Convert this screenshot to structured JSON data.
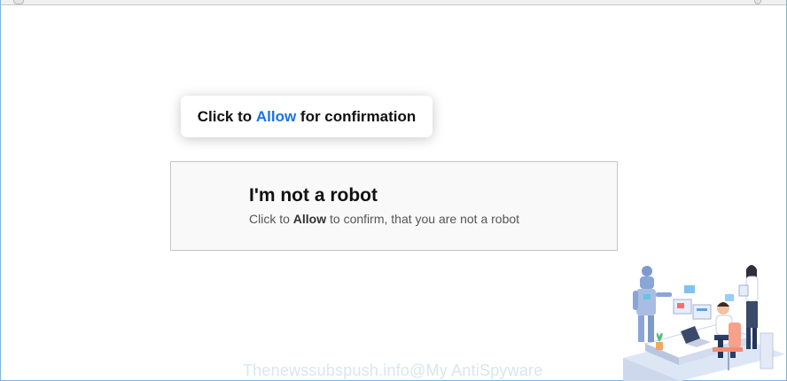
{
  "tooltip": {
    "prefix": "Click to ",
    "allow": "Allow",
    "suffix": " for confirmation"
  },
  "robot_box": {
    "title": "I'm not a robot",
    "sub_prefix": "Click to ",
    "sub_allow": "Allow",
    "sub_suffix": " to confirm, that you are not a robot"
  },
  "watermark": "Thenewssubspush.info@My AntiSpyware",
  "colors": {
    "allow_blue": "#1a73e8",
    "frame_border": "#7fb4dc"
  }
}
